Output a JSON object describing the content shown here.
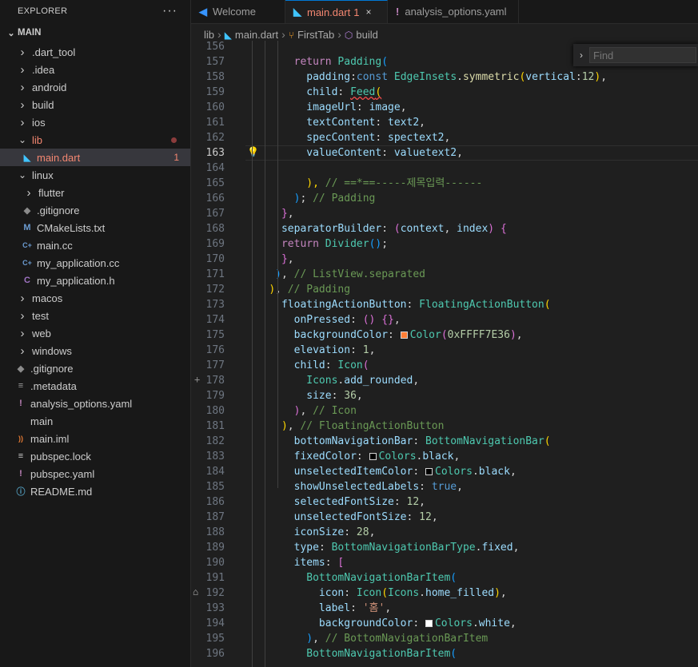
{
  "explorer": {
    "title": "EXPLORER",
    "more": "···",
    "root": "MAIN",
    "items": [
      {
        "kind": "folder",
        "label": ".dart_tool",
        "depth": 0,
        "open": false
      },
      {
        "kind": "folder",
        "label": ".idea",
        "depth": 0,
        "open": false
      },
      {
        "kind": "folder",
        "label": "android",
        "depth": 0,
        "open": false
      },
      {
        "kind": "folder",
        "label": "build",
        "depth": 0,
        "open": false
      },
      {
        "kind": "folder",
        "label": "ios",
        "depth": 0,
        "open": false
      },
      {
        "kind": "folder",
        "label": "lib",
        "depth": 0,
        "open": true,
        "error_dot": true,
        "color": "#f48771"
      },
      {
        "kind": "file",
        "label": "main.dart",
        "depth": 1,
        "icon": "dart-icon",
        "badge": "1",
        "color": "#f48771",
        "selected": true
      },
      {
        "kind": "folder",
        "label": "linux",
        "depth": 0,
        "open": true
      },
      {
        "kind": "folder",
        "label": "flutter",
        "depth": 1,
        "open": false
      },
      {
        "kind": "file",
        "label": ".gitignore",
        "depth": 1,
        "icon": "git-icon"
      },
      {
        "kind": "file",
        "label": "CMakeLists.txt",
        "depth": 1,
        "icon": "cmake-icon"
      },
      {
        "kind": "file",
        "label": "main.cc",
        "depth": 1,
        "icon": "cpp-icon"
      },
      {
        "kind": "file",
        "label": "my_application.cc",
        "depth": 1,
        "icon": "cpp-icon"
      },
      {
        "kind": "file",
        "label": "my_application.h",
        "depth": 1,
        "icon": "c-header-icon"
      },
      {
        "kind": "folder",
        "label": "macos",
        "depth": 0,
        "open": false
      },
      {
        "kind": "folder",
        "label": "test",
        "depth": 0,
        "open": false
      },
      {
        "kind": "folder",
        "label": "web",
        "depth": 0,
        "open": false
      },
      {
        "kind": "folder",
        "label": "windows",
        "depth": 0,
        "open": false
      },
      {
        "kind": "file",
        "label": ".gitignore",
        "depth": 0,
        "icon": "git-icon"
      },
      {
        "kind": "file",
        "label": ".metadata",
        "depth": 0,
        "icon": "metadata-icon"
      },
      {
        "kind": "file",
        "label": "analysis_options.yaml",
        "depth": 0,
        "icon": "yaml-icon"
      },
      {
        "kind": "file",
        "label": "main",
        "depth": 0,
        "icon": "none"
      },
      {
        "kind": "file",
        "label": "main.iml",
        "depth": 0,
        "icon": "rss-icon"
      },
      {
        "kind": "file",
        "label": "pubspec.lock",
        "depth": 0,
        "icon": "lines-icon"
      },
      {
        "kind": "file",
        "label": "pubspec.yaml",
        "depth": 0,
        "icon": "yaml-icon"
      },
      {
        "kind": "file",
        "label": "README.md",
        "depth": 0,
        "icon": "info-icon"
      }
    ]
  },
  "tabs": [
    {
      "label": "Welcome",
      "icon": "vscode-icon",
      "active": false
    },
    {
      "label": "main.dart",
      "badge": "1",
      "icon": "dart-icon",
      "active": true
    },
    {
      "label": "analysis_options.yaml",
      "icon": "yaml-icon",
      "active": false
    }
  ],
  "breadcrumb": [
    "lib",
    "main.dart",
    "FirstTab",
    "build"
  ],
  "find": {
    "placeholder": "Find"
  },
  "current_line": 163,
  "code": [
    {
      "n": 156,
      "t": []
    },
    {
      "n": 157,
      "t": [
        [
          "",
          "        "
        ],
        [
          "kw",
          "return "
        ],
        [
          "ty",
          "Padding"
        ],
        [
          "b3",
          "("
        ]
      ]
    },
    {
      "n": 158,
      "t": [
        [
          "",
          "          "
        ],
        [
          "pm",
          "padding"
        ],
        [
          "pl",
          ":"
        ],
        [
          "k",
          "const "
        ],
        [
          "ty",
          "EdgeInsets"
        ],
        [
          "pl",
          "."
        ],
        [
          "fn",
          "symmetric"
        ],
        [
          "b1",
          "("
        ],
        [
          "pm",
          "vertical"
        ],
        [
          "pl",
          ":"
        ],
        [
          "nm",
          "12"
        ],
        [
          "b1",
          ")"
        ],
        [
          "pl",
          ","
        ]
      ]
    },
    {
      "n": 159,
      "t": [
        [
          "",
          "          "
        ],
        [
          "pm",
          "child"
        ],
        [
          "pl",
          ": "
        ],
        [
          "ty squig",
          "Feed"
        ],
        [
          "b1 squig",
          "("
        ]
      ]
    },
    {
      "n": 160,
      "t": [
        [
          "",
          "          "
        ],
        [
          "pm",
          "imageUrl"
        ],
        [
          "pl",
          ": "
        ],
        [
          "pm",
          "image"
        ],
        [
          "pl",
          ","
        ]
      ]
    },
    {
      "n": 161,
      "t": [
        [
          "",
          "          "
        ],
        [
          "pm",
          "textContent"
        ],
        [
          "pl",
          ": "
        ],
        [
          "pm",
          "text2"
        ],
        [
          "pl",
          ","
        ]
      ]
    },
    {
      "n": 162,
      "t": [
        [
          "",
          "          "
        ],
        [
          "pm",
          "specContent"
        ],
        [
          "pl",
          ": "
        ],
        [
          "pm",
          "spectext2"
        ],
        [
          "pl",
          ","
        ]
      ]
    },
    {
      "n": 163,
      "t": [
        [
          "",
          "          "
        ],
        [
          "pm",
          "valueContent"
        ],
        [
          "pl",
          ": "
        ],
        [
          "pm",
          "valuetext2"
        ],
        [
          "pl",
          ","
        ]
      ]
    },
    {
      "n": 164,
      "t": []
    },
    {
      "n": 165,
      "t": [
        [
          "",
          "          "
        ],
        [
          "b1",
          "),"
        ],
        [
          "cm",
          " // ==*==-----제목입력------"
        ]
      ]
    },
    {
      "n": 166,
      "t": [
        [
          "",
          "        "
        ],
        [
          "b3",
          ")"
        ],
        [
          "pl",
          ";"
        ],
        [
          "cm",
          " // Padding"
        ]
      ]
    },
    {
      "n": 167,
      "t": [
        [
          "",
          "      "
        ],
        [
          "b2",
          "}"
        ],
        [
          "pl",
          ","
        ]
      ]
    },
    {
      "n": 168,
      "t": [
        [
          "",
          "      "
        ],
        [
          "pm",
          "separatorBuilder"
        ],
        [
          "pl",
          ": "
        ],
        [
          "b2",
          "("
        ],
        [
          "pm",
          "context"
        ],
        [
          "pl",
          ", "
        ],
        [
          "pm",
          "index"
        ],
        [
          "b2",
          ")"
        ],
        [
          "pl",
          " "
        ],
        [
          "b2",
          "{"
        ]
      ]
    },
    {
      "n": 169,
      "t": [
        [
          "",
          "      "
        ],
        [
          "kw",
          "return "
        ],
        [
          "ty",
          "Divider"
        ],
        [
          "b3",
          "()"
        ],
        [
          "pl",
          ";"
        ]
      ]
    },
    {
      "n": 170,
      "t": [
        [
          "",
          "      "
        ],
        [
          "b2",
          "}"
        ],
        [
          "pl",
          ","
        ]
      ]
    },
    {
      "n": 171,
      "t": [
        [
          "",
          "     "
        ],
        [
          "b3",
          ")"
        ],
        [
          "pl",
          ","
        ],
        [
          "cm",
          " // ListView.separated"
        ]
      ]
    },
    {
      "n": 172,
      "t": [
        [
          "",
          "    "
        ],
        [
          "b1",
          ")"
        ],
        [
          "pl",
          ","
        ],
        [
          "cm",
          " // Padding"
        ]
      ]
    },
    {
      "n": 173,
      "t": [
        [
          "",
          "      "
        ],
        [
          "pm",
          "floatingActionButton"
        ],
        [
          "pl",
          ": "
        ],
        [
          "ty",
          "FloatingActionButton"
        ],
        [
          "b1",
          "("
        ]
      ]
    },
    {
      "n": 174,
      "t": [
        [
          "",
          "        "
        ],
        [
          "pm",
          "onPressed"
        ],
        [
          "pl",
          ": "
        ],
        [
          "b2",
          "()"
        ],
        [
          "pl",
          " "
        ],
        [
          "b2",
          "{}"
        ],
        [
          "pl",
          ","
        ]
      ]
    },
    {
      "n": 175,
      "t": [
        [
          "",
          "        "
        ],
        [
          "pm",
          "backgroundColor"
        ],
        [
          "pl",
          ": "
        ],
        [
          "sw",
          "#FF7E36"
        ],
        [
          "ty",
          "Color"
        ],
        [
          "b2",
          "("
        ],
        [
          "nm",
          "0xFFFF7E36"
        ],
        [
          "b2",
          ")"
        ],
        [
          "pl",
          ","
        ]
      ]
    },
    {
      "n": 176,
      "t": [
        [
          "",
          "        "
        ],
        [
          "pm",
          "elevation"
        ],
        [
          "pl",
          ": "
        ],
        [
          "nm",
          "1"
        ],
        [
          "pl",
          ","
        ]
      ]
    },
    {
      "n": 177,
      "t": [
        [
          "",
          "        "
        ],
        [
          "pm",
          "child"
        ],
        [
          "pl",
          ": "
        ],
        [
          "ty",
          "Icon"
        ],
        [
          "b2",
          "("
        ]
      ]
    },
    {
      "n": 178,
      "t": [
        [
          "",
          "          "
        ],
        [
          "ty",
          "Icons"
        ],
        [
          "pl",
          "."
        ],
        [
          "pm",
          "add_rounded"
        ],
        [
          "pl",
          ","
        ]
      ]
    },
    {
      "n": 179,
      "t": [
        [
          "",
          "          "
        ],
        [
          "pm",
          "size"
        ],
        [
          "pl",
          ": "
        ],
        [
          "nm",
          "36"
        ],
        [
          "pl",
          ","
        ]
      ]
    },
    {
      "n": 180,
      "t": [
        [
          "",
          "        "
        ],
        [
          "b2",
          ")"
        ],
        [
          "pl",
          ","
        ],
        [
          "cm",
          " // Icon"
        ]
      ]
    },
    {
      "n": 181,
      "t": [
        [
          "",
          "      "
        ],
        [
          "b1",
          ")"
        ],
        [
          "pl",
          ","
        ],
        [
          "cm",
          " // FloatingActionButton"
        ]
      ]
    },
    {
      "n": 182,
      "t": [
        [
          "",
          "        "
        ],
        [
          "pm",
          "bottomNavigationBar"
        ],
        [
          "pl",
          ": "
        ],
        [
          "ty",
          "BottomNavigationBar"
        ],
        [
          "b1",
          "("
        ]
      ]
    },
    {
      "n": 183,
      "t": [
        [
          "",
          "        "
        ],
        [
          "pm",
          "fixedColor"
        ],
        [
          "pl",
          ": "
        ],
        [
          "sw",
          "#000000"
        ],
        [
          "ty",
          "Colors"
        ],
        [
          "pl",
          "."
        ],
        [
          "pm",
          "black"
        ],
        [
          "pl",
          ","
        ]
      ]
    },
    {
      "n": 184,
      "t": [
        [
          "",
          "        "
        ],
        [
          "pm",
          "unselectedItemColor"
        ],
        [
          "pl",
          ": "
        ],
        [
          "sw",
          "#000000"
        ],
        [
          "ty",
          "Colors"
        ],
        [
          "pl",
          "."
        ],
        [
          "pm",
          "black"
        ],
        [
          "pl",
          ","
        ]
      ]
    },
    {
      "n": 185,
      "t": [
        [
          "",
          "        "
        ],
        [
          "pm",
          "showUnselectedLabels"
        ],
        [
          "pl",
          ": "
        ],
        [
          "k",
          "true"
        ],
        [
          "pl",
          ","
        ]
      ]
    },
    {
      "n": 186,
      "t": [
        [
          "",
          "        "
        ],
        [
          "pm",
          "selectedFontSize"
        ],
        [
          "pl",
          ": "
        ],
        [
          "nm",
          "12"
        ],
        [
          "pl",
          ","
        ]
      ]
    },
    {
      "n": 187,
      "t": [
        [
          "",
          "        "
        ],
        [
          "pm",
          "unselectedFontSize"
        ],
        [
          "pl",
          ": "
        ],
        [
          "nm",
          "12"
        ],
        [
          "pl",
          ","
        ]
      ]
    },
    {
      "n": 188,
      "t": [
        [
          "",
          "        "
        ],
        [
          "pm",
          "iconSize"
        ],
        [
          "pl",
          ": "
        ],
        [
          "nm",
          "28"
        ],
        [
          "pl",
          ","
        ]
      ]
    },
    {
      "n": 189,
      "t": [
        [
          "",
          "        "
        ],
        [
          "pm",
          "type"
        ],
        [
          "pl",
          ": "
        ],
        [
          "ty",
          "BottomNavigationBarType"
        ],
        [
          "pl",
          "."
        ],
        [
          "pm",
          "fixed"
        ],
        [
          "pl",
          ","
        ]
      ]
    },
    {
      "n": 190,
      "t": [
        [
          "",
          "        "
        ],
        [
          "pm",
          "items"
        ],
        [
          "pl",
          ": "
        ],
        [
          "b2",
          "["
        ]
      ]
    },
    {
      "n": 191,
      "t": [
        [
          "",
          "          "
        ],
        [
          "ty",
          "BottomNavigationBarItem"
        ],
        [
          "b3",
          "("
        ]
      ]
    },
    {
      "n": 192,
      "t": [
        [
          "",
          "            "
        ],
        [
          "pm",
          "icon"
        ],
        [
          "pl",
          ": "
        ],
        [
          "ty",
          "Icon"
        ],
        [
          "b1",
          "("
        ],
        [
          "ty",
          "Icons"
        ],
        [
          "pl",
          "."
        ],
        [
          "pm",
          "home_filled"
        ],
        [
          "b1",
          ")"
        ],
        [
          "pl",
          ","
        ]
      ]
    },
    {
      "n": 193,
      "t": [
        [
          "",
          "            "
        ],
        [
          "pm",
          "label"
        ],
        [
          "pl",
          ": "
        ],
        [
          "st",
          "'홈'"
        ],
        [
          "pl",
          ","
        ]
      ]
    },
    {
      "n": 194,
      "t": [
        [
          "",
          "            "
        ],
        [
          "pm",
          "backgroundColor"
        ],
        [
          "pl",
          ": "
        ],
        [
          "sw",
          "#ffffff"
        ],
        [
          "ty",
          "Colors"
        ],
        [
          "pl",
          "."
        ],
        [
          "pm",
          "white"
        ],
        [
          "pl",
          ","
        ]
      ]
    },
    {
      "n": 195,
      "t": [
        [
          "",
          "          "
        ],
        [
          "b3",
          ")"
        ],
        [
          "pl",
          ","
        ],
        [
          "cm",
          " // BottomNavigationBarItem"
        ]
      ]
    },
    {
      "n": 196,
      "t": [
        [
          "",
          "          "
        ],
        [
          "ty",
          "BottomNavigationBarItem"
        ],
        [
          "b3",
          "("
        ]
      ]
    }
  ]
}
